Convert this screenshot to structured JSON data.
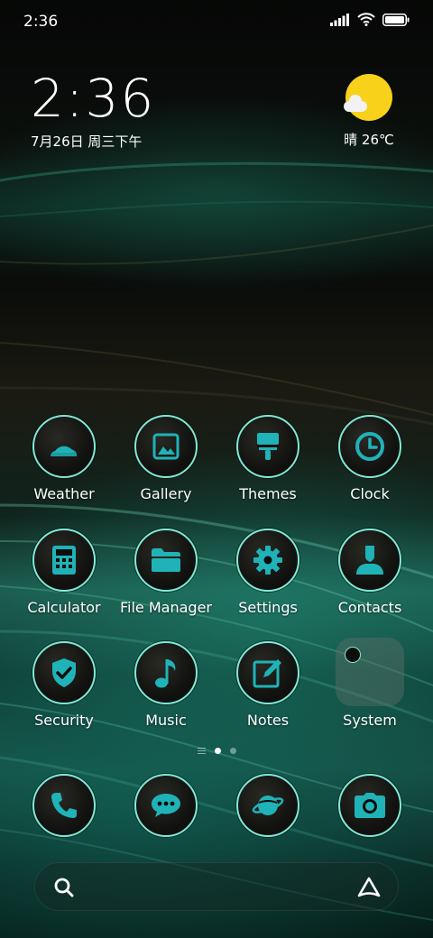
{
  "status_bar": {
    "time": "2:36",
    "icons": [
      "signal-icon",
      "wifi-icon",
      "battery-icon"
    ]
  },
  "clock_widget": {
    "time": "2:36",
    "date": "7月26日 周三下午"
  },
  "weather_widget": {
    "condition_icon": "sun-cloud-icon",
    "text": "晴 26℃"
  },
  "apps": [
    {
      "label": "Weather",
      "icon": "weather-icon"
    },
    {
      "label": "Gallery",
      "icon": "gallery-icon"
    },
    {
      "label": "Themes",
      "icon": "themes-brush-icon"
    },
    {
      "label": "Clock",
      "icon": "clock-icon"
    },
    {
      "label": "Calculator",
      "icon": "calculator-icon"
    },
    {
      "label": "File Manager",
      "icon": "folder-icon"
    },
    {
      "label": "Settings",
      "icon": "gear-icon"
    },
    {
      "label": "Contacts",
      "icon": "contact-person-icon"
    },
    {
      "label": "Security",
      "icon": "shield-check-icon"
    },
    {
      "label": "Music",
      "icon": "music-note-icon"
    },
    {
      "label": "Notes",
      "icon": "notes-edit-icon"
    },
    {
      "label": "System",
      "icon": "folder-group-icon"
    }
  ],
  "page_indicator": {
    "pages": 2,
    "active": 1
  },
  "dock": [
    {
      "icon": "phone-icon"
    },
    {
      "icon": "messages-icon"
    },
    {
      "icon": "browser-planet-icon"
    },
    {
      "icon": "camera-icon"
    }
  ],
  "search_bar": {
    "left_icon": "search-icon",
    "right_icon": "assistant-icon"
  },
  "colors": {
    "icon_accent": "#7fe9d6",
    "glyph": "#1fb3b8",
    "sun": "#f7d11a"
  }
}
